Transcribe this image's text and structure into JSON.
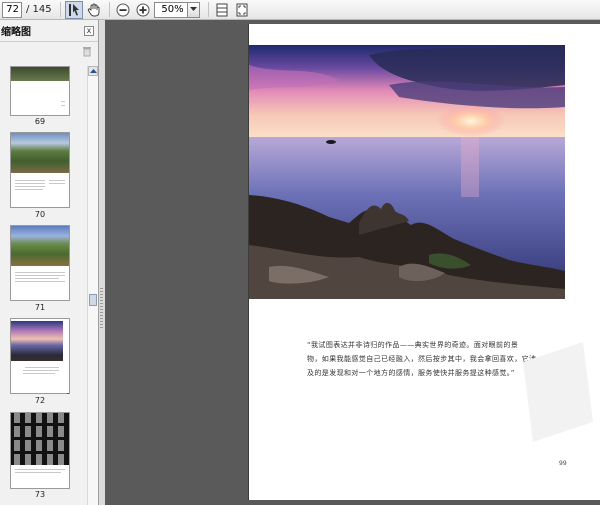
{
  "toolbar": {
    "page_current": "72",
    "page_total": "/ 145",
    "zoom_value": "50%",
    "icons": [
      "select-tool-icon",
      "hand-tool-icon",
      "zoom-out-icon",
      "zoom-in-icon",
      "fit-width-icon",
      "fit-page-icon"
    ]
  },
  "thumbnails_panel": {
    "title": "缩略图",
    "close_label": "x",
    "pages": [
      {
        "label": "69"
      },
      {
        "label": "70"
      },
      {
        "label": "71"
      },
      {
        "label": "72"
      },
      {
        "label": "73"
      }
    ]
  },
  "document": {
    "caption_lines": [
      "“我试图表达并非诗归的作品——典实世界的奇迹。面对眼前的景",
      "物，如果我能感觉自己已经融入，然后按步其中，我会拿回喜欢，它涉",
      "及的是发现和对一个地方的感情，服务使快并服务提这种感觉。”"
    ],
    "page_number": "99"
  },
  "colors": {
    "toolbar_bg": "#e6e6e6",
    "panel_bg": "#f1f1f1",
    "docarea_bg": "#5a5a5a",
    "page_bg": "#ffffff"
  }
}
